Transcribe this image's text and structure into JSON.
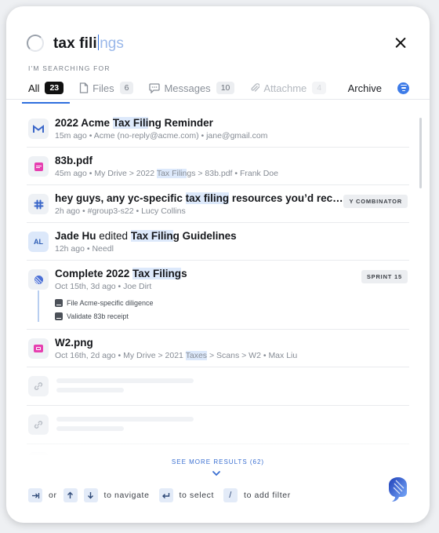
{
  "search": {
    "typed": "tax fili",
    "suggestion": "ngs",
    "label": "I'M SEARCHING FOR"
  },
  "tabs": [
    {
      "label": "All",
      "count": "23",
      "active": true
    },
    {
      "label": "Files",
      "count": "6"
    },
    {
      "label": "Messages",
      "count": "10"
    },
    {
      "label": "Attachme",
      "count": "4"
    }
  ],
  "archive_label": "Archive",
  "results": [
    {
      "title_pre": "2022 Acme ",
      "title_hl": "Tax Fili",
      "title_post": "ng Reminder",
      "meta": "15m ago • Acme (no-reply@acme.com) • jane@gmail.com",
      "icon": "gmail-icon"
    },
    {
      "title": "83b.pdf",
      "meta_pre": "45m ago • My Drive > 2022 ",
      "meta_hl": "Tax Filin",
      "meta_post": "gs > 83b.pdf • Frank Doe",
      "icon": "pdf-file-icon"
    },
    {
      "title_pre": "hey guys, any yc-specific ",
      "title_hl": "tax filing",
      "title_post": " resources you’d recommend?",
      "meta": "2h ago • #group3-s22 • Lucy Collins",
      "tag": "Y COMBINATOR",
      "icon": "slack-icon"
    },
    {
      "avatar_text": "AL",
      "title_pre": "Jade Hu",
      "title_mid": " edited ",
      "title_hl": "Tax Filin",
      "title_post": "g Guidelines",
      "meta": "12h ago • Needl"
    },
    {
      "title_pre": "Complete 2022 ",
      "title_hl": "Tax Filing",
      "title_post": "s",
      "meta": "Oct 15th, 3d ago • Joe Dirt",
      "tag": "SPRINT 15",
      "icon": "linear-icon",
      "subitems": [
        "File Acme-specific diligence",
        "Validate 83b receipt"
      ]
    },
    {
      "title": "W2.png",
      "meta_pre": "Oct 16th, 2d ago • My Drive > 2021 ",
      "meta_hl": "Taxes",
      "meta_post": " > Scans > W2 • Max Liu",
      "icon": "image-file-icon"
    }
  ],
  "see_more": "SEE MORE RESULTS (62)",
  "footer": {
    "or": "or",
    "navigate": "to navigate",
    "select": "to select",
    "filter_key": "/",
    "filter": "to add filter"
  },
  "colors": {
    "accent": "#2f6fde",
    "highlight": "#dde9fb"
  }
}
